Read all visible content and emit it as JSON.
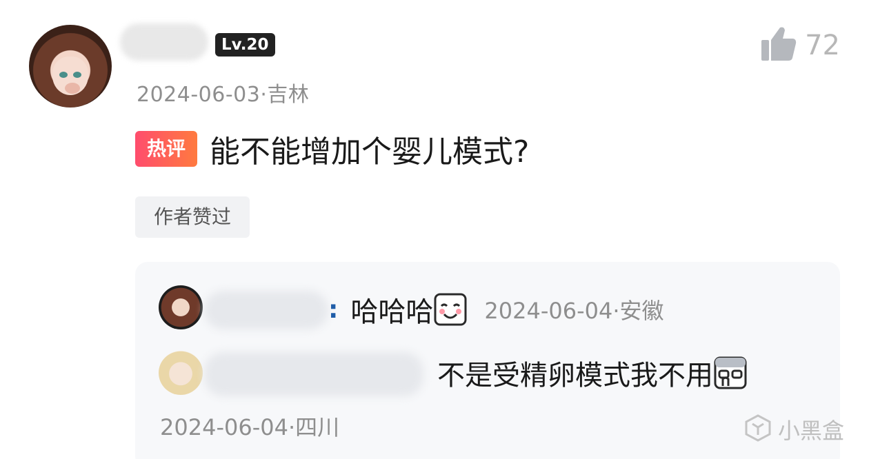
{
  "comment": {
    "level_badge": "Lv.20",
    "meta": "2024-06-03·吉林",
    "hot_tag": "热评",
    "text": "能不能增加个婴儿模式?",
    "author_liked": "作者赞过",
    "like_count": "72"
  },
  "replies": [
    {
      "colon": ":",
      "text": "哈哈哈",
      "emoji": "smiling-face-emoji",
      "meta": "2024-06-04·安徽"
    },
    {
      "text": "不是受精卵模式我不用",
      "emoji": "thinking-emoji",
      "meta": "2024-06-04·四川"
    }
  ],
  "watermark": "小黑盒",
  "colors": {
    "hot_start": "#ff4d6d",
    "hot_end": "#ff7a3f",
    "meta_gray": "#8e8e8e",
    "reply_bg": "#f7f8fa"
  }
}
